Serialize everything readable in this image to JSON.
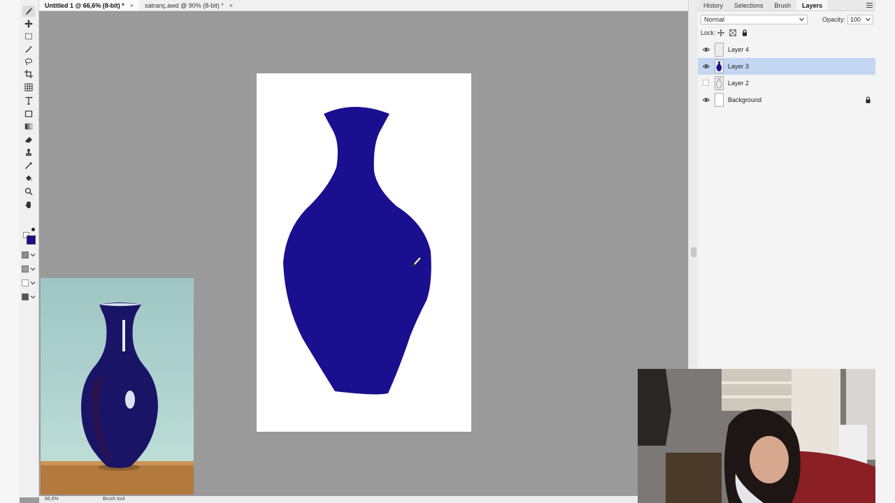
{
  "tabs": [
    {
      "label": "Untitled 1 @ 66,6% (8-bit) *",
      "close": "×"
    },
    {
      "label": "satranç.awd @ 90% (8-bit) *",
      "close": "×"
    }
  ],
  "tools": [
    "brush-tool",
    "move-tool",
    "rect-select-tool",
    "magic-wand-tool",
    "lasso-tool",
    "crop-tool",
    "grid-tool",
    "text-tool",
    "shape-tool",
    "gradient-tool",
    "eraser-tool",
    "stamp-tool",
    "eyedropper-tool",
    "fill-tool",
    "zoom-tool",
    "hand-tool"
  ],
  "colors": {
    "foreground": "#1a0f8f",
    "background": "#ffffff",
    "paint": "#1a0f8f"
  },
  "status": {
    "zoom": "66,6%",
    "tool": "Brush tool"
  },
  "panel": {
    "tabs": [
      "History",
      "Selections",
      "Brush",
      "Layers"
    ],
    "active_tab": "Layers",
    "blend_mode": "Normal",
    "opacity_label": "Opacity:",
    "opacity_value": "100",
    "lock_label": "Lock:",
    "layers": [
      {
        "name": "Layer 4",
        "visible": true,
        "selected": false,
        "locked": false
      },
      {
        "name": "Layer 3",
        "visible": true,
        "selected": true,
        "locked": false
      },
      {
        "name": "Layer 2",
        "visible": false,
        "selected": false,
        "locked": false
      },
      {
        "name": "Background",
        "visible": true,
        "selected": false,
        "locked": true
      }
    ]
  }
}
